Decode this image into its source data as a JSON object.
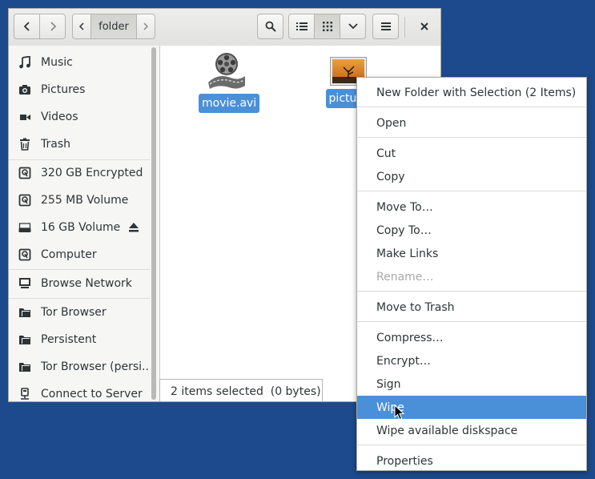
{
  "header": {
    "back_icon": "go-back-icon",
    "forward_icon": "go-forward-icon",
    "path_prev_icon": "path-left-icon",
    "path_label": "folder",
    "path_next_icon": "path-right-icon",
    "search_icon": "search-icon",
    "list_view_icon": "list-view-icon",
    "grid_view_icon": "grid-view-icon",
    "view_options_icon": "chevron-down-icon",
    "menu_icon": "hamburger-menu-icon",
    "close_icon": "close-icon"
  },
  "sidebar": {
    "items": [
      {
        "label": "Music",
        "icon": "music-note-icon"
      },
      {
        "label": "Pictures",
        "icon": "camera-icon"
      },
      {
        "label": "Videos",
        "icon": "film-icon"
      },
      {
        "label": "Trash",
        "icon": "trash-icon"
      },
      {
        "label": "320 GB Encrypted",
        "icon": "drive-icon"
      },
      {
        "label": "255 MB Volume",
        "icon": "drive-icon"
      },
      {
        "label": "16 GB Volume",
        "icon": "drive-icon"
      },
      {
        "label": "Computer",
        "icon": "drive-icon"
      },
      {
        "label": "Browse Network",
        "icon": "network-icon"
      },
      {
        "label": "Tor Browser",
        "icon": "folder-icon"
      },
      {
        "label": "Persistent",
        "icon": "folder-icon"
      },
      {
        "label": "Tor Browser (persi...",
        "icon": "folder-icon"
      },
      {
        "label": "Connect to Server",
        "icon": "server-icon"
      }
    ],
    "eject_icon": "eject-icon"
  },
  "files": [
    {
      "name": "movie.avi",
      "icon": "film-reel-icon"
    },
    {
      "name": "picture",
      "icon": "image-icon"
    }
  ],
  "status": {
    "text": "2 items selected  (0 bytes)"
  },
  "context_menu": {
    "items": [
      {
        "label": "New Folder with Selection (2 Items)",
        "state": "normal"
      },
      {
        "label": "Open",
        "state": "normal"
      },
      {
        "label": "Cut",
        "state": "normal"
      },
      {
        "label": "Copy",
        "state": "normal"
      },
      {
        "label": "Move To…",
        "state": "normal"
      },
      {
        "label": "Copy To…",
        "state": "normal"
      },
      {
        "label": "Make Links",
        "state": "normal"
      },
      {
        "label": "Rename…",
        "state": "disabled"
      },
      {
        "label": "Move to Trash",
        "state": "normal"
      },
      {
        "label": "Compress…",
        "state": "normal"
      },
      {
        "label": "Encrypt…",
        "state": "normal"
      },
      {
        "label": "Sign",
        "state": "normal"
      },
      {
        "label": "Wipe",
        "state": "highlighted"
      },
      {
        "label": "Wipe available diskspace",
        "state": "normal"
      },
      {
        "label": "Properties",
        "state": "normal"
      }
    ]
  },
  "colors": {
    "desktop": "#1d4a8c",
    "selection": "#4a90d9"
  }
}
